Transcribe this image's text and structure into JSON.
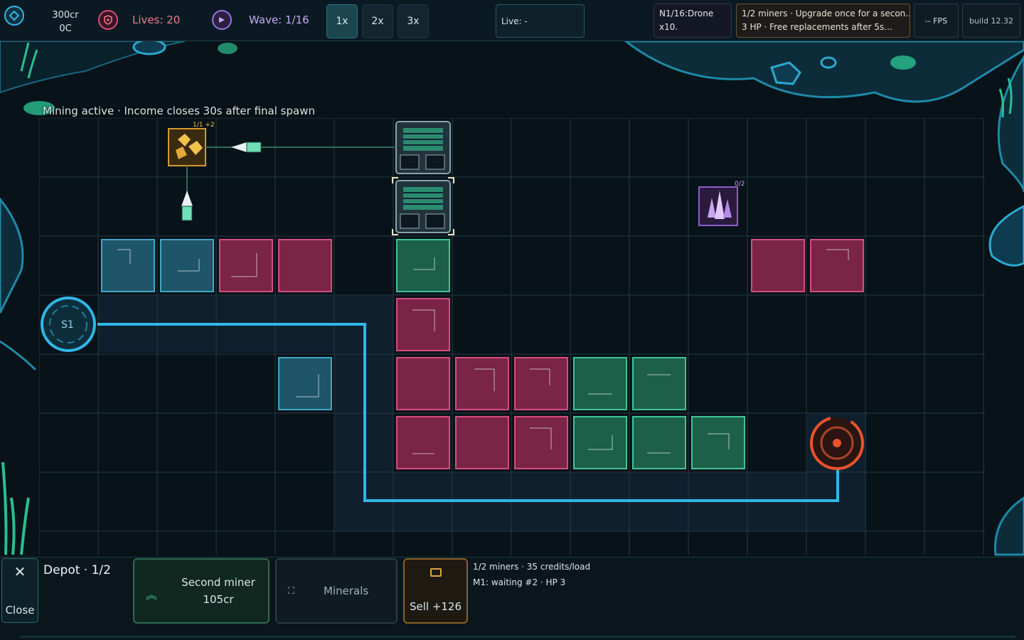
{
  "hud": {
    "credits": "300cr",
    "cores": "0C",
    "lives": "Lives: 20",
    "wave": "Wave: 1/16",
    "speeds": [
      "1x",
      "2x",
      "3x"
    ],
    "active_speed": "1x",
    "live": "Live: -",
    "next_wave_line1": "N1/16:Drone",
    "next_wave_line2": "x10.",
    "tip_line1": "1/2 miners · Upgrade once for a secon...",
    "tip_line2": "3 HP · Free replacements after 5s...",
    "fps": "-- FPS",
    "build": "build 12.32"
  },
  "status_line": "Mining active · Income closes 30s after final spawn",
  "board": {
    "spawn_label": "S1",
    "gold_node_badge": "1/1 +2",
    "crystal_node_badge": "0/2",
    "colors": {
      "blue": "#3fa7c6",
      "red": "#d54d7f",
      "green": "#3fc495",
      "path": "#2fb7e8",
      "core": "#e8532c"
    }
  },
  "panel": {
    "close_label": "Close",
    "title": "Depot · 1/2",
    "second_miner_label": "Second miner",
    "second_miner_cost": "105cr",
    "minerals_label": "Minerals",
    "sell_label": "Sell +126",
    "info_line1": "1/2 miners · 35 credits/load",
    "info_line2": "M1: waiting #2 · HP 3"
  }
}
